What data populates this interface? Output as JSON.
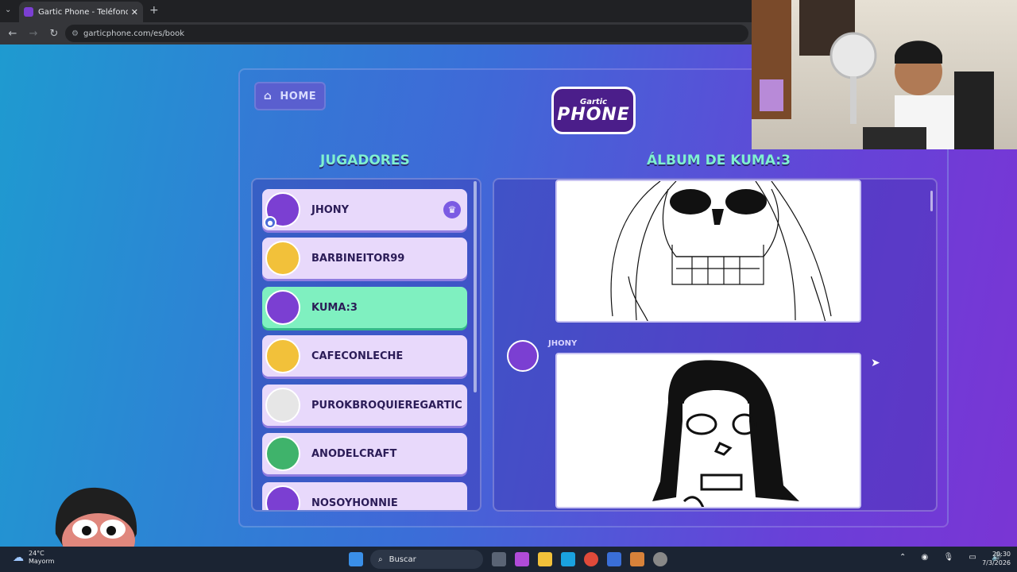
{
  "browser": {
    "tab_title": "Gartic Phone - Teléfono Descon",
    "tab_close": "✕",
    "new_tab": "+",
    "url": "garticphone.com/es/book"
  },
  "game": {
    "home_label": "HOME",
    "logo_top": "Gartic",
    "logo_main": "PHONE",
    "players_heading": "JUGADORES",
    "album_heading": "ÁLBUM DE KUMA:3",
    "players": [
      {
        "name": "JHONY",
        "avatar_color": "#7b3fd2",
        "host": true
      },
      {
        "name": "BARBINEITOR99",
        "avatar_color": "#f2c13a"
      },
      {
        "name": "KUMA:3",
        "avatar_color": "#7b3fd2",
        "active": true
      },
      {
        "name": "CAFECONLECHE",
        "avatar_color": "#f2c13a"
      },
      {
        "name": "PUROKBROQUIEREGARTIC",
        "avatar_color": "#e6e6e6"
      },
      {
        "name": "ANODELCRAFT",
        "avatar_color": "#3fb36b"
      },
      {
        "name": "NOSOYHONNIE",
        "avatar_color": "#7b3fd2"
      }
    ],
    "album_author": "JHONY"
  },
  "taskbar": {
    "temp": "24°C",
    "weather_text": "Mayorm",
    "search_placeholder": "Buscar",
    "time": "20:30",
    "date": "7/3/2026"
  },
  "colors": {
    "accent_mint": "#7ff0c0",
    "player_bg": "#e8d9fb",
    "heading": "#7ff0d0"
  }
}
